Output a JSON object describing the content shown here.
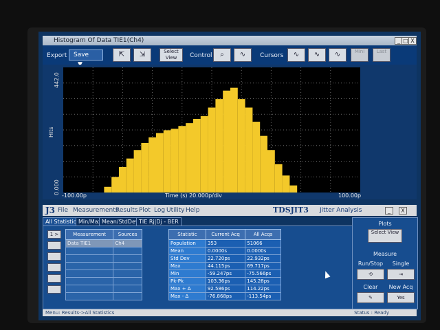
{
  "window": {
    "title": "Histogram Of Data TIE1(Ch4)",
    "buttons": [
      "_",
      "□",
      "X"
    ]
  },
  "toolbar": {
    "export_label": "Export",
    "save_dropdown": "Save",
    "select_view": "Select View",
    "control_label": "Control",
    "cursors_label": "Cursors",
    "mini_label": "Mini",
    "last_label": "Last"
  },
  "plot": {
    "y_axis_label": "Hits",
    "y_max_label": "442.0",
    "y_min_label": "0.000",
    "x_min_label": "-100.00p",
    "x_center_label": "Time (s)  20.000p/div",
    "x_max_label": "100.00p",
    "colors": {
      "background": "#000000",
      "bars": "#f3c92a",
      "grid": "#666666"
    }
  },
  "chart_data": {
    "type": "bar",
    "title": "Histogram Of Data TIE1(Ch4)",
    "xlabel": "Time (s)  20.000p/div",
    "ylabel": "Hits",
    "xlim": [
      -100,
      100
    ],
    "ylim": [
      0,
      442
    ],
    "x": [
      -75,
      -70,
      -65,
      -60,
      -55,
      -50,
      -45,
      -40,
      -35,
      -30,
      -25,
      -20,
      -15,
      -10,
      -5,
      0,
      5,
      10,
      15,
      20,
      25,
      30,
      35,
      40,
      45,
      50,
      55,
      60
    ],
    "values": [
      0,
      20,
      55,
      90,
      120,
      150,
      175,
      195,
      210,
      220,
      225,
      235,
      245,
      260,
      270,
      300,
      330,
      360,
      370,
      330,
      300,
      250,
      200,
      150,
      100,
      60,
      25,
      0
    ]
  },
  "app_menu": {
    "logo": "J3",
    "items": [
      "File",
      "Measurements",
      "Results",
      "Plot",
      "Log",
      "Utility",
      "Help"
    ],
    "brand": "TDSJIT3",
    "subtitle": "Jitter Analysis"
  },
  "tabs": [
    {
      "label": "All Statistics",
      "active": true
    },
    {
      "label": "Min/Max",
      "active": false
    },
    {
      "label": "Mean/StdDev",
      "active": false
    },
    {
      "label": "TIE Rj|Dj - BER",
      "active": false
    }
  ],
  "left_buttons": [
    "1 >",
    "",
    "",
    "",
    "",
    ""
  ],
  "measurements": {
    "headers": [
      "Measurement",
      "Sources"
    ],
    "rows": [
      [
        "Data TIE1",
        "Ch4"
      ],
      [
        "",
        ""
      ],
      [
        "",
        ""
      ],
      [
        "",
        ""
      ],
      [
        "",
        ""
      ],
      [
        "",
        ""
      ],
      [
        "",
        ""
      ],
      [
        "",
        ""
      ]
    ]
  },
  "statistics": {
    "headers": [
      "Statistic",
      "Current Acq",
      "All Acqs"
    ],
    "rows": [
      [
        "Population",
        "353",
        "51066"
      ],
      [
        "Mean",
        "0.0000s",
        "0.0000s"
      ],
      [
        "Std Dev",
        "22.720ps",
        "22.932ps"
      ],
      [
        "Max",
        "44.115ps",
        "69.717ps"
      ],
      [
        "Min",
        "-59.247ps",
        "-75.566ps"
      ],
      [
        "Pk-Pk",
        "103.36ps",
        "145.28ps"
      ],
      [
        "Max + Δ",
        "92.586ps",
        "114.22ps"
      ],
      [
        "Max - Δ",
        "-76.868ps",
        "-113.54ps"
      ]
    ]
  },
  "right_panel": {
    "plots_label": "Plots",
    "select_view": "Select View",
    "measure_label": "Measure",
    "runstop_label": "Run/Stop",
    "single_label": "Single",
    "clear_label": "Clear",
    "newacq_label": "New Acq",
    "yes_label": "Yes"
  },
  "status": {
    "left": "Menu: Results->All Statistics",
    "right": "Status : Ready"
  }
}
